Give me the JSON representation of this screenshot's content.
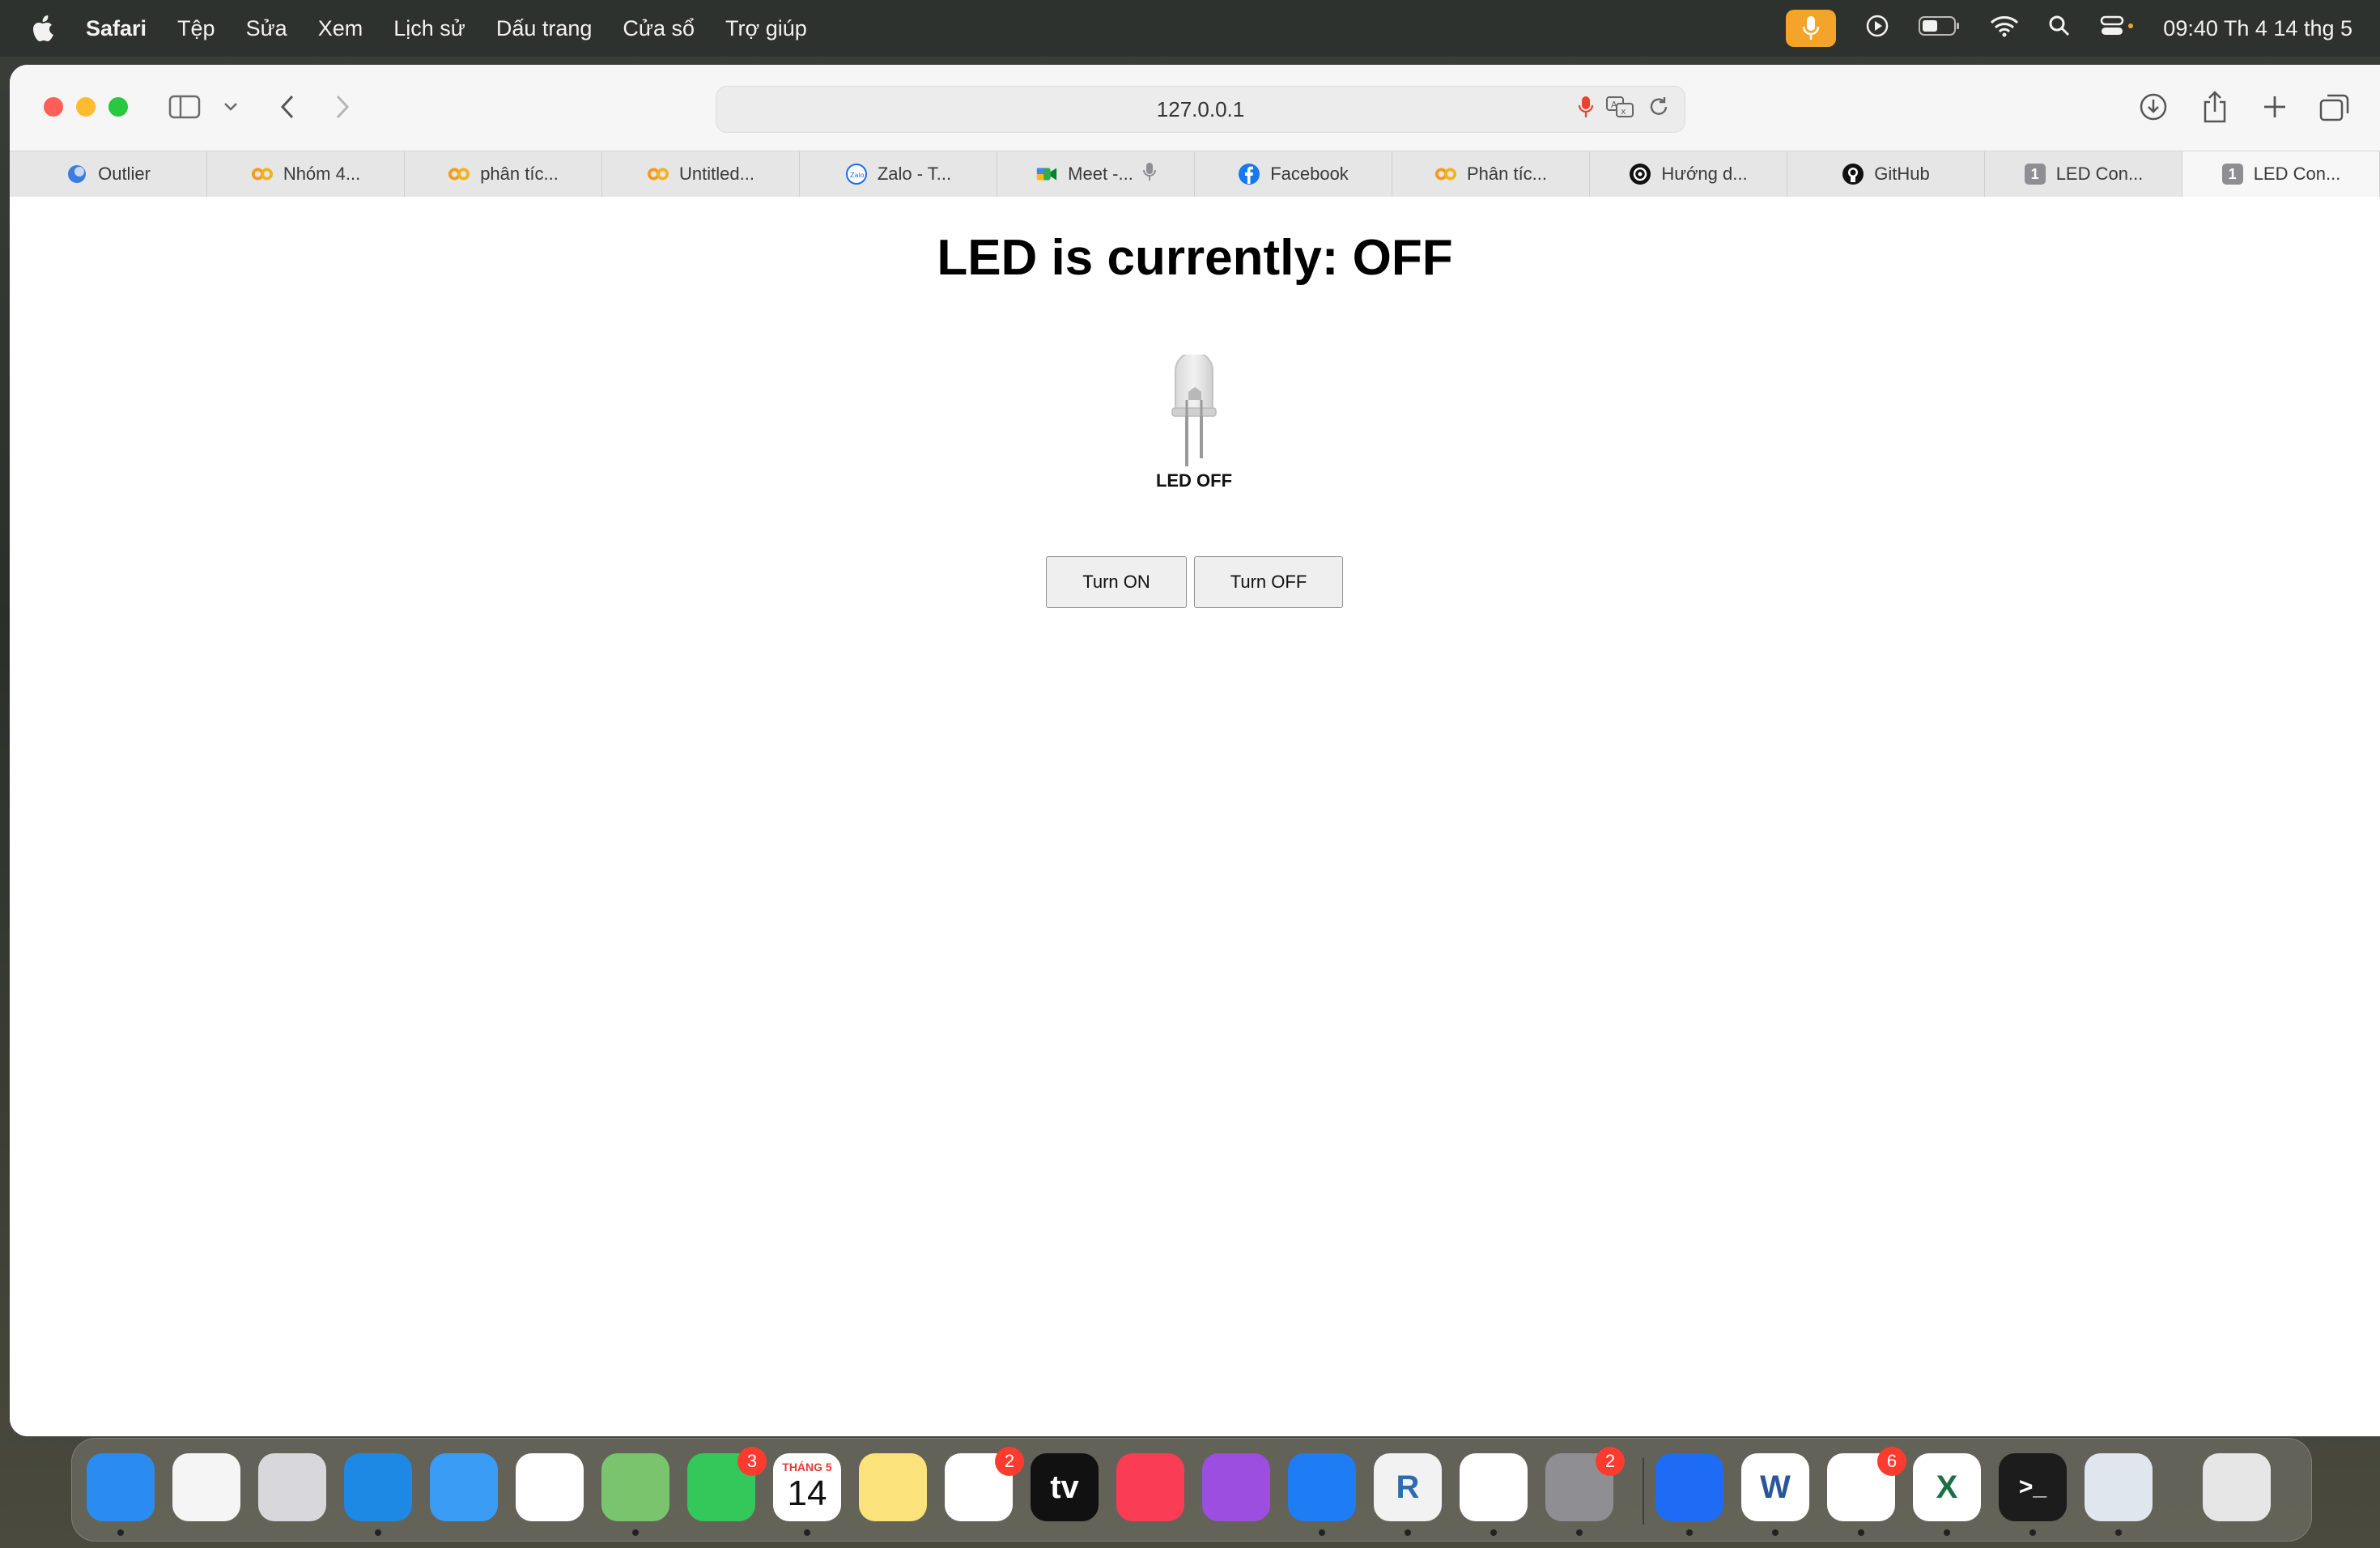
{
  "menubar": {
    "app_name": "Safari",
    "items": [
      "Tệp",
      "Sửa",
      "Xem",
      "Lịch sử",
      "Dấu trang",
      "Cửa sổ",
      "Trợ giúp"
    ],
    "clock": "09:40 Th 4 14 thg 5"
  },
  "browser": {
    "url": "127.0.0.1",
    "tabs": [
      {
        "label": "Outlier",
        "icon": "outlier-icon"
      },
      {
        "label": "Nhóm 4...",
        "icon": "colab-icon"
      },
      {
        "label": "phân tíc...",
        "icon": "colab-icon"
      },
      {
        "label": "Untitled...",
        "icon": "colab-icon"
      },
      {
        "label": "Zalo - T...",
        "icon": "zalo-icon"
      },
      {
        "label": "Meet -...",
        "icon": "meet-icon"
      },
      {
        "label": "Facebook",
        "icon": "facebook-icon"
      },
      {
        "label": "Phân tíc...",
        "icon": "colab-icon"
      },
      {
        "label": "Hướng d...",
        "icon": "chatgpt-icon"
      },
      {
        "label": "GitHub",
        "icon": "github-icon"
      },
      {
        "label": "LED Con...",
        "icon": "badge-1-icon",
        "badge": "1"
      },
      {
        "label": "LED Con...",
        "icon": "badge-1-icon",
        "badge": "1",
        "active": true
      }
    ]
  },
  "page": {
    "title": "LED is currently: OFF",
    "led_caption": "LED OFF",
    "btn_on": "Turn ON",
    "btn_off": "Turn OFF"
  },
  "dock": {
    "apps": [
      {
        "name": "finder",
        "color": "#2a8cf0"
      },
      {
        "name": "freeform",
        "color": "#f5f5f5"
      },
      {
        "name": "launchpad",
        "color": "#d8d8dc"
      },
      {
        "name": "safari",
        "color": "#1e88e5"
      },
      {
        "name": "mail",
        "color": "#3a9cf5"
      },
      {
        "name": "photos",
        "color": "#ffffff"
      },
      {
        "name": "maps",
        "color": "#7ac46e"
      },
      {
        "name": "facetime",
        "color": "#34c759",
        "badge": "3"
      },
      {
        "name": "calendar",
        "color": "#ffffff",
        "month": "THÁNG 5",
        "day": "14"
      },
      {
        "name": "notes",
        "color": "#fbe27a"
      },
      {
        "name": "reminders",
        "color": "#ffffff",
        "badge": "2"
      },
      {
        "name": "apple-tv",
        "color": "#111111",
        "text": "tv"
      },
      {
        "name": "music",
        "color": "#fa3c55"
      },
      {
        "name": "podcasts",
        "color": "#9b4ee0"
      },
      {
        "name": "app-store",
        "color": "#1e7cf5"
      },
      {
        "name": "r-app",
        "color": "#f2f2f2",
        "text": "R"
      },
      {
        "name": "vscode",
        "color": "#ffffff"
      },
      {
        "name": "system-settings",
        "color": "#8e8e93",
        "badge": "2"
      },
      {
        "name": "klack",
        "color": "#1e6cf5"
      },
      {
        "name": "word",
        "color": "#ffffff",
        "text": "W"
      },
      {
        "name": "messenger",
        "color": "#ffffff",
        "badge": "6"
      },
      {
        "name": "excel",
        "color": "#ffffff",
        "text": "X"
      },
      {
        "name": "terminal",
        "color": "#1c1c1c",
        "text": ">_"
      },
      {
        "name": "preview",
        "color": "#dfe6ee"
      },
      {
        "name": "trash",
        "color": "#e6e6e6"
      }
    ]
  },
  "colors": {
    "accent_mic": "#f4a42a",
    "traffic_red": "#fe5f57",
    "traffic_yellow": "#febc2e",
    "traffic_green": "#28c840"
  }
}
